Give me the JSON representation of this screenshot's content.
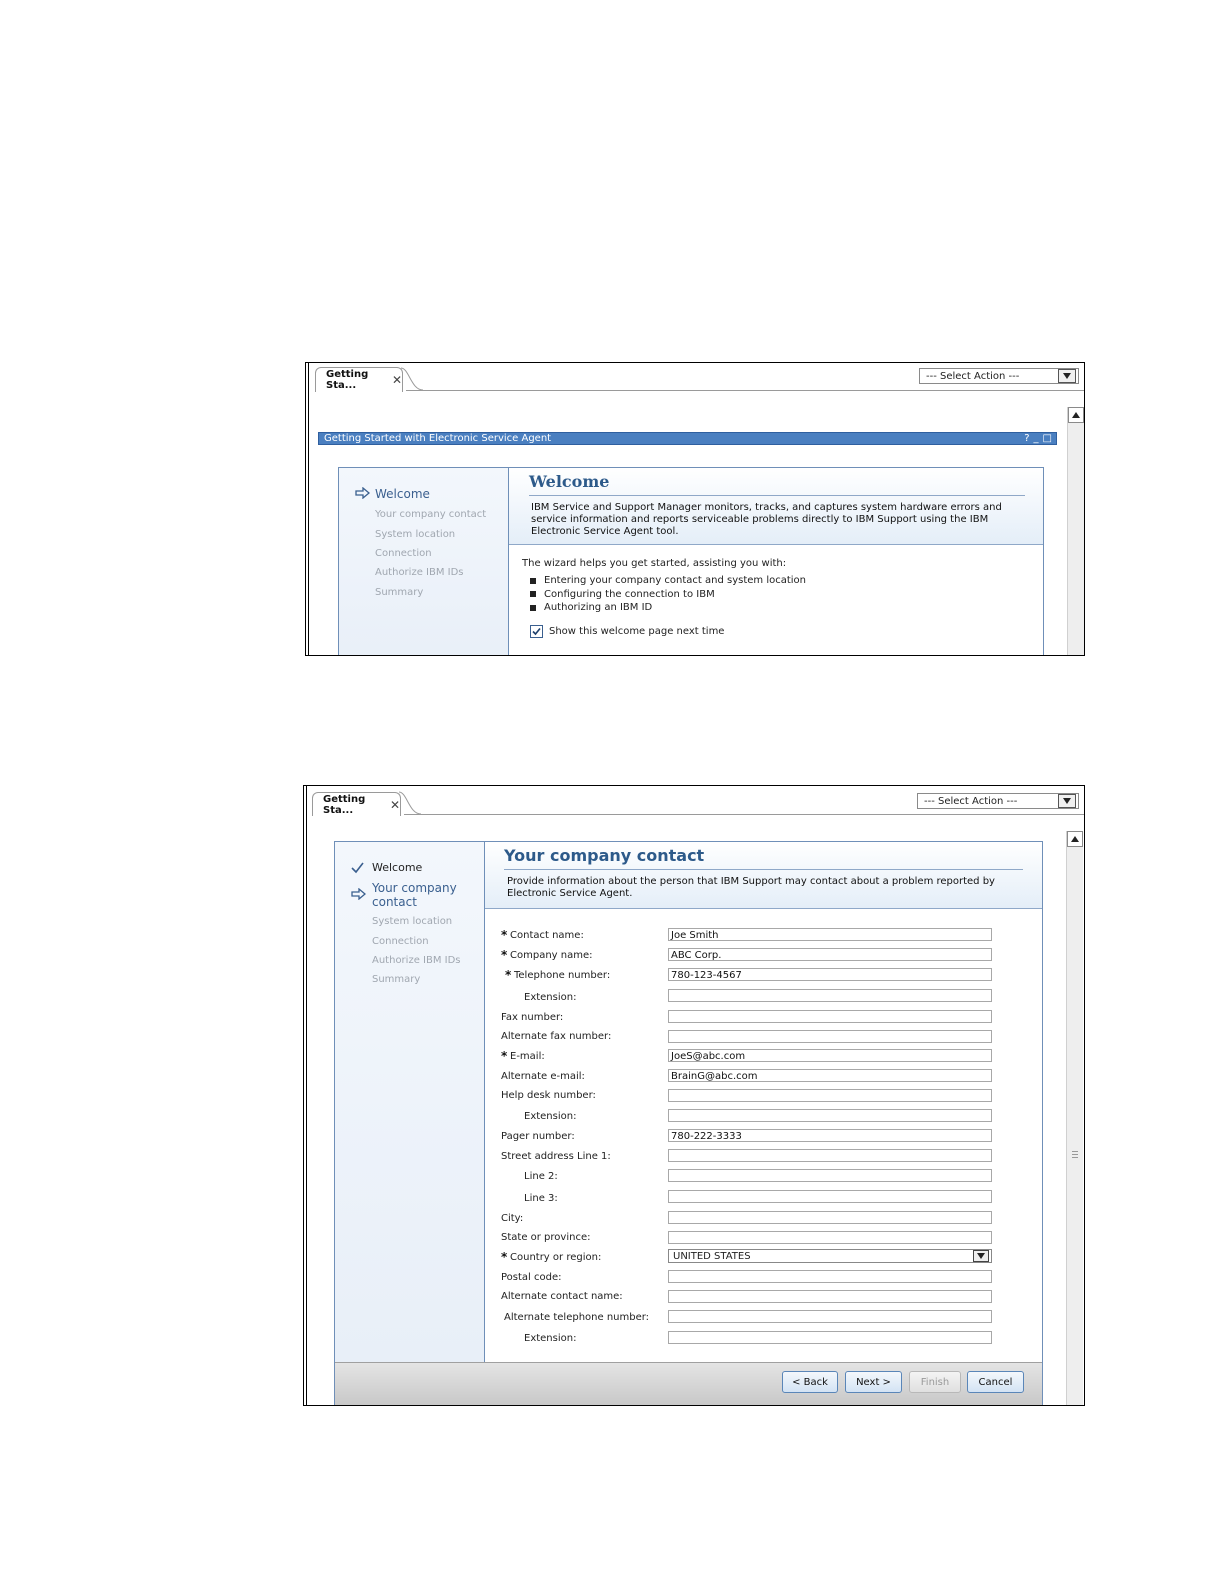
{
  "panel1": {
    "tab_label": "Getting Sta...",
    "tab_close": "✕",
    "select_action": "--- Select Action ---",
    "title": "Getting Started with Electronic Service Agent",
    "title_icons": [
      "?",
      "_",
      "□"
    ],
    "nav": [
      {
        "label": "Welcome",
        "state": "current"
      },
      {
        "label": "Your company contact",
        "state": "pending"
      },
      {
        "label": "System location",
        "state": "pending"
      },
      {
        "label": "Connection",
        "state": "pending"
      },
      {
        "label": "Authorize IBM IDs",
        "state": "pending"
      },
      {
        "label": "Summary",
        "state": "pending"
      }
    ],
    "heading": "Welcome",
    "description": "IBM Service and Support Manager monitors, tracks, and captures system hardware errors and service information and reports serviceable problems directly to IBM Support using the IBM Electronic Service Agent tool.",
    "intro": "The wizard helps you get started, assisting you with:",
    "bullets": [
      "Entering your company contact and system location",
      "Configuring the connection to IBM",
      "Authorizing an IBM ID"
    ],
    "show_welcome_label": "Show this welcome page next time",
    "show_welcome_checked": true
  },
  "panel2": {
    "tab_label": "Getting Sta...",
    "tab_close": "✕",
    "select_action": "--- Select Action ---",
    "nav": [
      {
        "label": "Welcome",
        "state": "done"
      },
      {
        "label": "Your company contact",
        "state": "current"
      },
      {
        "label": "System location",
        "state": "pending"
      },
      {
        "label": "Connection",
        "state": "pending"
      },
      {
        "label": "Authorize IBM IDs",
        "state": "pending"
      },
      {
        "label": "Summary",
        "state": "pending"
      }
    ],
    "heading": "Your company contact",
    "description": "Provide information about the person that IBM Support may contact about a problem reported by Electronic Service Agent.",
    "required_marker": "*",
    "fields": [
      {
        "label": "Contact name:",
        "value": "Joe Smith",
        "required": true
      },
      {
        "label": "Company name:",
        "value": "ABC Corp.",
        "required": true
      },
      {
        "label": "Telephone number:",
        "value": "780-123-4567",
        "required": true
      },
      {
        "label": "Extension:",
        "value": "",
        "required": false
      },
      {
        "label": "Fax number:",
        "value": "",
        "required": false
      },
      {
        "label": "Alternate fax number:",
        "value": "",
        "required": false
      },
      {
        "label": "E-mail:",
        "value": "JoeS@abc.com",
        "required": true
      },
      {
        "label": "Alternate e-mail:",
        "value": "BrainG@abc.com",
        "required": false
      },
      {
        "label": "Help desk number:",
        "value": "",
        "required": false
      },
      {
        "label": "Extension:",
        "value": "",
        "required": false
      },
      {
        "label": "Pager number:",
        "value": "780-222-3333",
        "required": false
      },
      {
        "label": "Street address Line 1:",
        "value": "",
        "required": false
      },
      {
        "label": "Line 2:",
        "value": "",
        "required": false
      },
      {
        "label": "Line 3:",
        "value": "",
        "required": false
      },
      {
        "label": "City:",
        "value": "",
        "required": false
      },
      {
        "label": "State or province:",
        "value": "",
        "required": false
      },
      {
        "label": "Country or region:",
        "value": "UNITED STATES",
        "required": true
      },
      {
        "label": "Postal code:",
        "value": "",
        "required": false
      },
      {
        "label": "Alternate contact name:",
        "value": "",
        "required": false
      },
      {
        "label": "Alternate telephone number:",
        "value": "",
        "required": false
      },
      {
        "label": "Extension:",
        "value": "",
        "required": false
      }
    ],
    "buttons": {
      "back": "< Back",
      "next": "Next >",
      "finish": "Finish",
      "cancel": "Cancel"
    }
  },
  "colors": {
    "title_bar": "#4a7fc0",
    "heading": "#2d5a8a",
    "nav_current": "#3a5f8f",
    "nav_pending": "#a0a7b0",
    "border_blue": "#6f8fb8"
  }
}
